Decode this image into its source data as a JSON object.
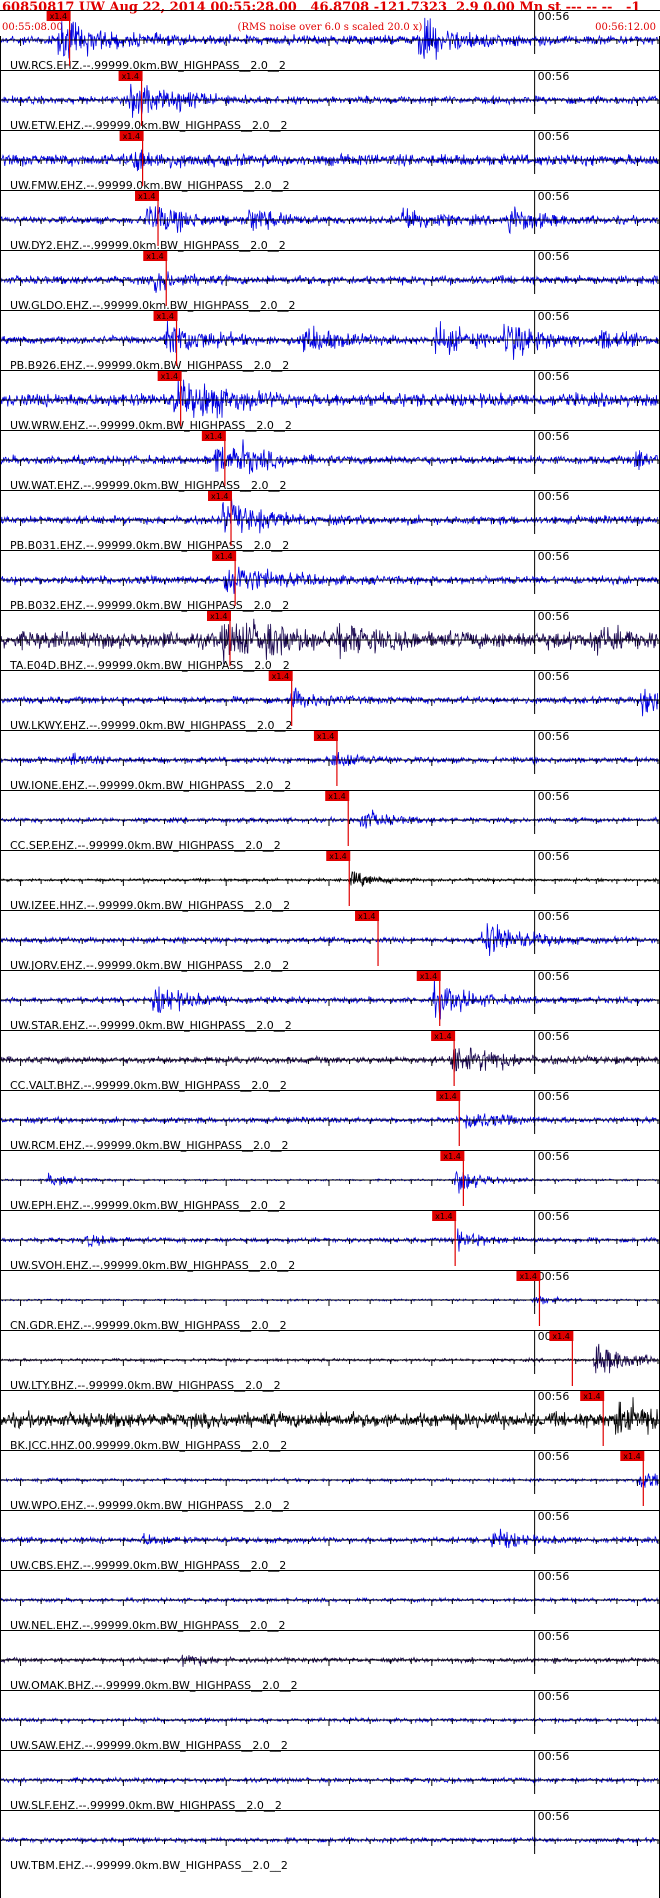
{
  "header": {
    "title": "60850817 UW Aug 22, 2014 00:55:28.00   46.8708 -121.7323  2.9 0.00 Mn st --- -- --   -1",
    "start_time": "00:55:08.00",
    "note": "(RMS noise over 6.0 s scaled 20.0 x)",
    "end_time": "00:56:12.00"
  },
  "colors": {
    "header_red": "#e00000",
    "trace_blue": "#0000e0",
    "trace_navy": "#1a0850",
    "trace_black": "#000000",
    "pick_red": "#e00000"
  },
  "chart_data": {
    "type": "seismogram",
    "x_range": [
      "00:55:08.00",
      "00:56:12.00"
    ],
    "minute_mark_label": "00:56",
    "pick_label": "x1.4",
    "traces": [
      {
        "label": "UW.RCS.EHZ.--.99999.0km.BW_HIGHPASS__2.0__2",
        "pick_time": 5.7,
        "color": "blue",
        "amp": 0.25,
        "events": [
          [
            5.8,
            1.0
          ],
          [
            40.8,
            1.0
          ]
        ]
      },
      {
        "label": "UW.ETW.EHZ.--.99999.0km.BW_HIGHPASS__2.0__2",
        "pick_time": 12.7,
        "color": "blue",
        "amp": 0.2,
        "events": [
          [
            12.8,
            0.9
          ],
          [
            17.5,
            0.3
          ]
        ]
      },
      {
        "label": "UW.FMW.EHZ.--.99999.0km.BW_HIGHPASS__2.0__2",
        "pick_time": 12.8,
        "color": "blue",
        "amp": 0.3,
        "events": [
          [
            12.9,
            0.6
          ]
        ]
      },
      {
        "label": "UW.DY2.EHZ.--.99999.0km.BW_HIGHPASS__2.0__2",
        "pick_time": 14.3,
        "color": "blue",
        "amp": 0.2,
        "events": [
          [
            14.4,
            0.9
          ],
          [
            24.3,
            0.6
          ],
          [
            39.2,
            0.7
          ],
          [
            49.5,
            0.7
          ]
        ]
      },
      {
        "label": "UW.GLDO.EHZ.--.99999.0km.BW_HIGHPASS__2.0__2",
        "pick_time": 15.1,
        "color": "blue",
        "amp": 0.22,
        "events": [
          [
            15.2,
            0.5
          ]
        ]
      },
      {
        "label": "PB.B926.EHZ.--.99999.0km.BW_HIGHPASS__2.0__2",
        "pick_time": 16.1,
        "color": "blue",
        "amp": 0.2,
        "events": [
          [
            16.2,
            1.0
          ],
          [
            29.6,
            0.8
          ],
          [
            42.5,
            0.8
          ],
          [
            49.1,
            1.0
          ],
          [
            58.4,
            0.5
          ]
        ]
      },
      {
        "label": "UW.WRW.EHZ.--.99999.0km.BW_HIGHPASS__2.0__2",
        "pick_time": 16.5,
        "color": "blue",
        "amp": 0.35,
        "events": [
          [
            17.0,
            0.9
          ],
          [
            19.5,
            0.6
          ]
        ]
      },
      {
        "label": "UW.WAT.EHZ.--.99999.0km.BW_HIGHPASS__2.0__2",
        "pick_time": 20.8,
        "color": "blue",
        "amp": 0.22,
        "events": [
          [
            21.0,
            0.8
          ],
          [
            23.0,
            0.5
          ],
          [
            61.8,
            0.5
          ]
        ]
      },
      {
        "label": "PB.B031.EHZ.--.99999.0km.BW_HIGHPASS__2.0__2",
        "pick_time": 21.4,
        "color": "blue",
        "amp": 0.22,
        "events": [
          [
            21.6,
            1.0
          ]
        ]
      },
      {
        "label": "PB.B032.EHZ.--.99999.0km.BW_HIGHPASS__2.0__2",
        "pick_time": 21.8,
        "color": "blue",
        "amp": 0.22,
        "events": [
          [
            22.0,
            1.0
          ]
        ]
      },
      {
        "label": "TA.E04D.BHZ.--.99999.0km.BW_HIGHPASS__2.0__2",
        "pick_time": 21.3,
        "color": "navy",
        "amp": 0.45,
        "events": [
          [
            21.8,
            0.9
          ],
          [
            23.0,
            0.9
          ],
          [
            33.0,
            0.6
          ],
          [
            58.0,
            0.5
          ]
        ]
      },
      {
        "label": "UW.LKWY.EHZ.--.99999.0km.BW_HIGHPASS__2.0__2",
        "pick_time": 27.3,
        "color": "blue",
        "amp": 0.18,
        "events": [
          [
            28.5,
            0.5
          ],
          [
            62.5,
            1.0
          ]
        ]
      },
      {
        "label": "UW.IONE.EHZ.--.99999.0km.BW_HIGHPASS__2.0__2",
        "pick_time": 31.7,
        "color": "blue",
        "amp": 0.15,
        "events": [
          [
            32.5,
            0.5
          ],
          [
            7.0,
            0.3
          ]
        ]
      },
      {
        "label": "CC.SEP.EHZ.--.99999.0km.BW_HIGHPASS__2.0__2",
        "pick_time": 32.8,
        "color": "blue",
        "amp": 0.12,
        "events": [
          [
            35.0,
            0.6
          ]
        ]
      },
      {
        "label": "UW.IZEE.HHZ.--.99999.0km.BW_HIGHPASS__2.0__2",
        "pick_time": 32.9,
        "color": "black",
        "amp": 0.08,
        "events": [
          [
            34.3,
            0.4
          ]
        ]
      },
      {
        "label": "UW.JORV.EHZ.--.99999.0km.BW_HIGHPASS__2.0__2",
        "pick_time": 35.7,
        "color": "blue",
        "amp": 0.15,
        "events": [
          [
            47.0,
            1.0
          ]
        ]
      },
      {
        "label": "UW.STAR.EHZ.--.99999.0km.BW_HIGHPASS__2.0__2",
        "pick_time": 41.7,
        "color": "blue",
        "amp": 0.15,
        "events": [
          [
            15.0,
            0.8
          ],
          [
            42.3,
            0.9
          ]
        ]
      },
      {
        "label": "CC.VALT.BHZ.--.99999.0km.BW_HIGHPASS__2.0__2",
        "pick_time": 43.1,
        "color": "navy",
        "amp": 0.18,
        "events": [
          [
            44.0,
            0.8
          ],
          [
            47.0,
            0.4
          ]
        ]
      },
      {
        "label": "UW.RCM.EHZ.--.99999.0km.BW_HIGHPASS__2.0__2",
        "pick_time": 43.6,
        "color": "blue",
        "amp": 0.15,
        "events": [
          [
            45.5,
            0.6
          ]
        ]
      },
      {
        "label": "UW.EPH.EHZ.--.99999.0km.BW_HIGHPASS__2.0__2",
        "pick_time": 44.0,
        "color": "blue",
        "amp": 0.05,
        "events": [
          [
            4.7,
            0.4
          ],
          [
            44.4,
            0.7
          ]
        ]
      },
      {
        "label": "UW.SVOH.EHZ.--.99999.0km.BW_HIGHPASS__2.0__2",
        "pick_time": 43.2,
        "color": "blue",
        "amp": 0.12,
        "events": [
          [
            8.5,
            0.3
          ],
          [
            44.6,
            0.5
          ]
        ]
      },
      {
        "label": "CN.GDR.EHZ.--.99999.0km.BW_HIGHPASS__2.0__2",
        "pick_time": 51.4,
        "color": "blue",
        "amp": 0.05,
        "events": [
          [
            52.0,
            0.3
          ]
        ]
      },
      {
        "label": "UW.LTY.BHZ.--.99999.0km.BW_HIGHPASS__2.0__2",
        "pick_time": 54.6,
        "color": "navy",
        "amp": 0.08,
        "events": [
          [
            58.0,
            0.9
          ]
        ]
      },
      {
        "label": "BK.JCC.HHZ.00.99999.0km.BW_HIGHPASS__2.0__2",
        "pick_time": 57.6,
        "color": "black",
        "amp": 0.4,
        "events": [
          [
            60.0,
            1.0
          ]
        ]
      },
      {
        "label": "UW.WPO.EHZ.--.99999.0km.BW_HIGHPASS__2.0__2",
        "pick_time": 61.5,
        "color": "blue",
        "amp": 0.08,
        "events": [
          [
            62.2,
            0.7
          ]
        ]
      },
      {
        "label": "UW.CBS.EHZ.--.99999.0km.BW_HIGHPASS__2.0__2",
        "pick_time": null,
        "color": "blue",
        "amp": 0.15,
        "events": [
          [
            48.0,
            0.6
          ],
          [
            14.0,
            0.3
          ]
        ]
      },
      {
        "label": "UW.NEL.EHZ.--.99999.0km.BW_HIGHPASS__2.0__2",
        "pick_time": null,
        "color": "blue",
        "amp": 0.1,
        "events": []
      },
      {
        "label": "UW.OMAK.BHZ.--.99999.0km.BW_HIGHPASS__2.0__2",
        "pick_time": null,
        "color": "navy",
        "amp": 0.12,
        "events": [
          [
            17.8,
            0.4
          ]
        ]
      },
      {
        "label": "UW.SAW.EHZ.--.99999.0km.BW_HIGHPASS__2.0__2",
        "pick_time": null,
        "color": "blue",
        "amp": 0.1,
        "events": []
      },
      {
        "label": "UW.SLF.EHZ.--.99999.0km.BW_HIGHPASS__2.0__2",
        "pick_time": null,
        "color": "blue",
        "amp": 0.12,
        "events": []
      },
      {
        "label": "UW.TBM.EHZ.--.99999.0km.BW_HIGHPASS__2.0__2",
        "pick_time": null,
        "color": "blue",
        "amp": 0.12,
        "events": []
      }
    ]
  }
}
